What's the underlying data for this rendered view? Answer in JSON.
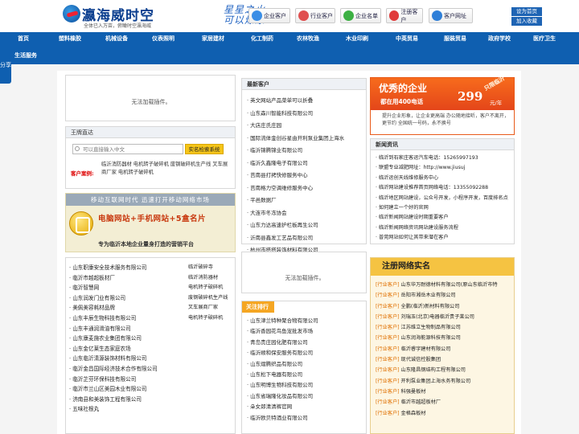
{
  "header": {
    "logo_title": "瀛海威时空",
    "logo_slogan": "全体已入万亩，俯瞰时空瀛海威",
    "calligraphy": "星星之火 可以燎原",
    "buttons": [
      "企业客户",
      "行业客户",
      "企业名单",
      "注册客户",
      "客户网址"
    ],
    "home_label": "设为首页",
    "fav_label": "加入收藏"
  },
  "nav": {
    "row1": [
      "首页",
      "塑料橡胶",
      "机械设备",
      "仪表照明",
      "家居建材",
      "化工制药",
      "农林牧渔",
      "木业印刷",
      "中英贸易",
      "服装贸易",
      "政府学校",
      "医疗卫生"
    ],
    "row2": "生活服务",
    "share": "分享"
  },
  "plugin_msg_1": "无法加载插件。",
  "plugin_msg_2": "无法加载插件。",
  "search": {
    "title": "王牌直达",
    "placeholder": "可以直接输入中文",
    "button": "实名检索系统",
    "cases_label": "客户案例:",
    "cases": "临沂消防器材 电机转子破碎机 废钢破碎机生产线 叉车展商厂家 电机转子破碎机"
  },
  "banner": {
    "top": "移动互联网时代 迅速打开移动网络市场",
    "mid": "电脑网站+手机网站+5盒名片",
    "bottom": "专为临沂本地企业量身打造的营销平台"
  },
  "company_list_left": [
    "山东职康安全技术服务有限公司",
    "临沂市越超板材厂",
    "临沂智慧网",
    "山东润发门业有限公司",
    "美佩美容耗材品牌",
    "山东丰辰生物科技有限公司",
    "山东丰通润滑油有限公司",
    "山东康麦施农业集团有限公司",
    "山东金亿莱生态家庭农场",
    "山东临沂清源装饰材料有限公司",
    "临沂金昌国际经济技术合作有限公司",
    "临沂芷芬环保科技有限公司",
    "临沂市兰山区美园木业有限公司",
    "济南县和美装饰工程有限公司",
    "五味社根丸"
  ],
  "company_list_right": [
    "临沂破碎寺",
    "临沂消防器材",
    "电机转子破碎机",
    "废钢破碎机生产线",
    "叉车展商厂家",
    "电机转子破碎机"
  ],
  "latest": {
    "title": "最新客户",
    "items": [
      "英文网站产品菜单可以折叠",
      "山东森川智能科技有限公司",
      "大店庄氏庄园",
      "国际流体金创谷星由开利泵业集团上海水",
      "临沂锦腾锦业有限公司",
      "临沂久鑫隆电子有限公司",
      "莒南县打拷快修服务中心",
      "莒南格力空调维修服务中心",
      "平邑数据厂",
      "大连市冬冻协会",
      "山东力达高速护栏板再生公司",
      "沂南县鑫发工艺品有限公司",
      "杭州市搭搭装饰材料有限公司"
    ]
  },
  "focus": {
    "title": "关注排行",
    "items": [
      "山东津兰特种聚合物有限公司",
      "临沂香园花鸟鱼宠批发市场",
      "青岛贵庄园化肥有限公司",
      "临沂顺和保安服务有限公司",
      "山东熠腾织品有限公司",
      "山东松下电器有限公司",
      "山东明博生物科技有限公司",
      "山东省瑞隆化妆品有限公司",
      "朵女郎清清裤官网",
      "临沂欧贝特酒业有限公司"
    ]
  },
  "promo": {
    "title": "优秀的企业",
    "subtitle": "都在用400电话",
    "price": "299",
    "unit": "元/年",
    "badge": "只限临沂",
    "desc": "提升企业形象，让企业更高端 办公随地接听，客户不离开，更节约 全国统一号码，永不换号"
  },
  "news": {
    "title": "新闻资讯",
    "items": [
      "临沂到石家庄客运汽车电话：15265997193",
      "联盟专业减肥网址：http://www.jiusuj",
      "临沂运创天线维修服务中心",
      "临沂网站建设推荐首页网络电话：13355092288",
      "临沂地区网站建设，公众号开发，小程序开发，百度排名点",
      "如何建立一个好的官网",
      "临沂新闻网站建设时期重要客户",
      "临沂新闻网络资讯网站建设服务流程",
      "普莞网站如何让其带来潜在客户"
    ]
  },
  "register": {
    "title": "注册网络实名",
    "tag": "[行业客户]",
    "items": [
      "山东华万耐德材料有限公司(原山东临沂市特",
      "岳阳市湘岳木业有限公司",
      "全鹏(临沂)新材料有限公司",
      "刘瑞玉(北京)电器临沂贵子莱公司",
      "江苏维立生物制品有限公司",
      "山东润海能源科技有限公司",
      "临沂睿宇建材有限公司",
      "现代诚信控股集团",
      "山东隆昌钢结构工程有限公司",
      "开利泵业集团上海水务有限公司",
      "科强曼板材",
      "临沂市越超板材厂",
      "金格森板材"
    ]
  }
}
